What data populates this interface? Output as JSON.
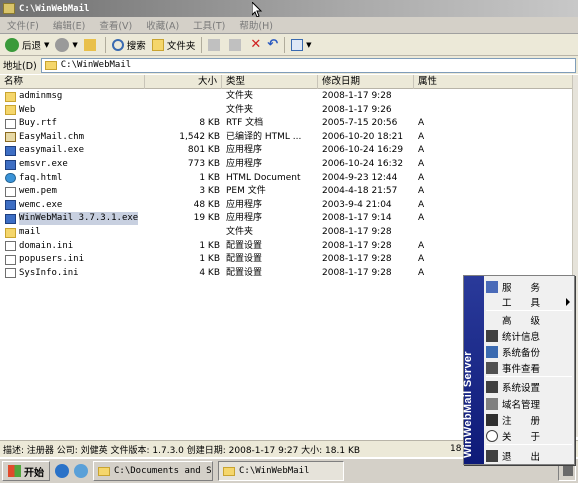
{
  "window": {
    "title": "C:\\WinWebMail"
  },
  "menubar": {
    "items": [
      "文件(F)",
      "编辑(E)",
      "查看(V)",
      "收藏(A)",
      "工具(T)",
      "帮助(H)"
    ]
  },
  "toolbar": {
    "back_label": "后退",
    "search_label": "搜索",
    "folders_label": "文件夹"
  },
  "addressbar": {
    "label": "地址(D)",
    "value": "C:\\WinWebMail"
  },
  "filelist": {
    "columns": {
      "name": "名称",
      "size": "大小",
      "type": "类型",
      "date": "修改日期",
      "attr": "属性"
    },
    "rows": [
      {
        "name": "adminmsg",
        "size": "",
        "type": "文件夹",
        "date": "2008-1-17 9:28",
        "attr": "",
        "icon": "folder-icon"
      },
      {
        "name": "Web",
        "size": "",
        "type": "文件夹",
        "date": "2008-1-17 9:26",
        "attr": "",
        "icon": "folder-icon"
      },
      {
        "name": "Buy.rtf",
        "size": "8 KB",
        "type": "RTF 文档",
        "date": "2005-7-15 20:56",
        "attr": "A",
        "icon": "document-icon"
      },
      {
        "name": "EasyMail.chm",
        "size": "1,542 KB",
        "type": "已编译的 HTML ...",
        "date": "2006-10-20 18:21",
        "attr": "A",
        "icon": "help-file-icon"
      },
      {
        "name": "easymail.exe",
        "size": "801 KB",
        "type": "应用程序",
        "date": "2006-10-24 16:29",
        "attr": "A",
        "icon": "application-icon"
      },
      {
        "name": "emsvr.exe",
        "size": "773 KB",
        "type": "应用程序",
        "date": "2006-10-24 16:32",
        "attr": "A",
        "icon": "application-icon"
      },
      {
        "name": "faq.html",
        "size": "1 KB",
        "type": "HTML Document",
        "date": "2004-9-23 12:44",
        "attr": "A",
        "icon": "web-page-icon"
      },
      {
        "name": "wem.pem",
        "size": "3 KB",
        "type": "PEM 文件",
        "date": "2004-4-18 21:57",
        "attr": "A",
        "icon": "document-icon"
      },
      {
        "name": "wemc.exe",
        "size": "48 KB",
        "type": "应用程序",
        "date": "2003-9-4 21:04",
        "attr": "A",
        "icon": "application-icon"
      },
      {
        "name": "WinWebMail  3.7.3.1.exe",
        "size": "19 KB",
        "type": "应用程序",
        "date": "2008-1-17 9:14",
        "attr": "A",
        "icon": "installer-icon"
      },
      {
        "name": "mail",
        "size": "",
        "type": "文件夹",
        "date": "2008-1-17 9:28",
        "attr": "",
        "icon": "folder-icon"
      },
      {
        "name": "domain.ini",
        "size": "1 KB",
        "type": "配置设置",
        "date": "2008-1-17 9:28",
        "attr": "A",
        "icon": "settings-file-icon"
      },
      {
        "name": "popusers.ini",
        "size": "1 KB",
        "type": "配置设置",
        "date": "2008-1-17 9:28",
        "attr": "A",
        "icon": "settings-file-icon"
      },
      {
        "name": "SysInfo.ini",
        "size": "4 KB",
        "type": "配置设置",
        "date": "2008-1-17 9:28",
        "attr": "A",
        "icon": "settings-file-icon"
      }
    ]
  },
  "statusbar": {
    "text": "描述: 注册器 公司: 刘健英 文件版本: 1.7.3.0 创建日期: 2008-1-17 9:27 大小: 18.1 KB",
    "right_text": "18"
  },
  "taskbar": {
    "start_label": "开始",
    "tasks": [
      "C:\\Documents and Se...",
      "C:\\WinWebMail"
    ]
  },
  "context_menu": {
    "band_title": "WinWebMail Server",
    "items": [
      {
        "label": "服　　务",
        "icon": "service-icon"
      },
      {
        "label": "工　　具",
        "icon": "",
        "submenu": true
      },
      {
        "label": "高　　级",
        "icon": ""
      },
      {
        "label": "统计信息",
        "icon": "statistics-icon"
      },
      {
        "label": "系统备份",
        "icon": "backup-icon"
      },
      {
        "label": "事件查看",
        "icon": "event-viewer-icon"
      },
      {
        "label": "系统设置",
        "icon": "system-settings-icon"
      },
      {
        "label": "域名管理",
        "icon": "domain-management-icon"
      },
      {
        "label": "注　　册",
        "icon": "lock-icon"
      },
      {
        "label": "关　　于",
        "icon": "about-icon"
      },
      {
        "label": "退　　出",
        "icon": "exit-icon"
      }
    ]
  }
}
